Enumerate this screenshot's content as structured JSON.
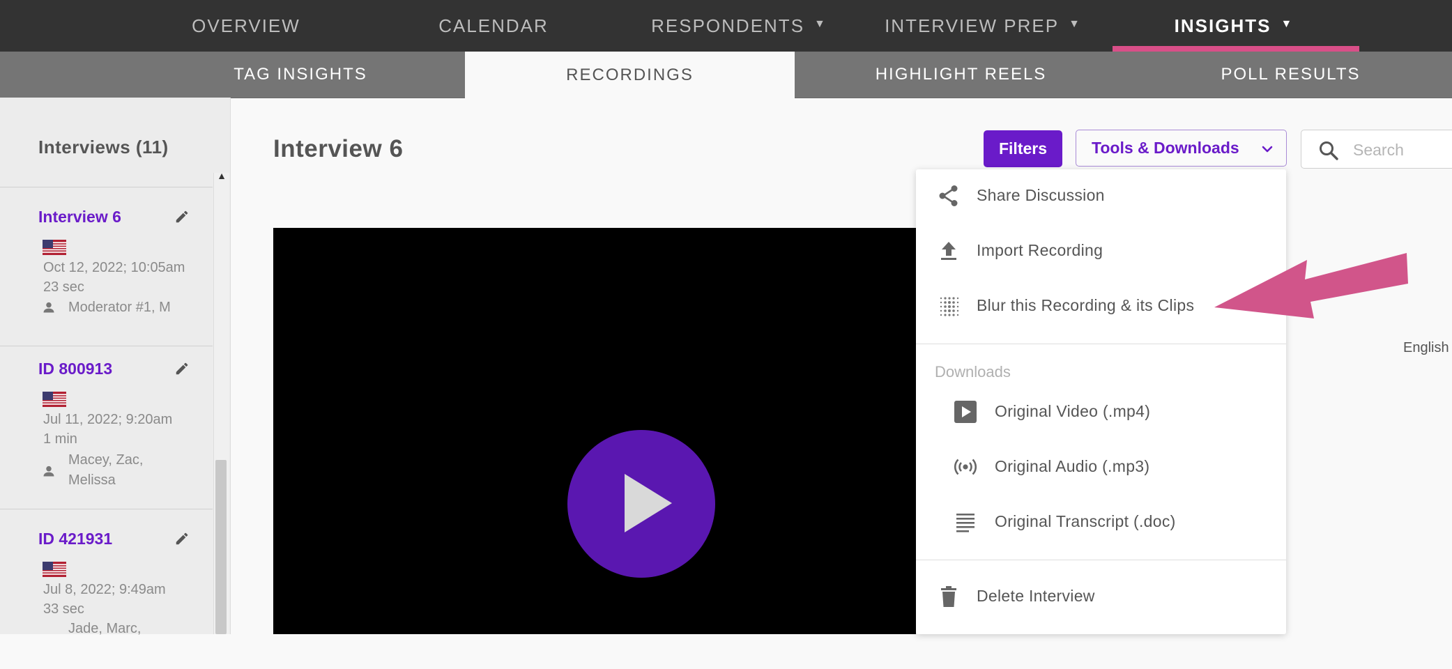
{
  "top_nav": {
    "items": [
      {
        "label": "OVERVIEW",
        "has_caret": false
      },
      {
        "label": "CALENDAR",
        "has_caret": false
      },
      {
        "label": "RESPONDENTS",
        "has_caret": true
      },
      {
        "label": "INTERVIEW PREP",
        "has_caret": true
      },
      {
        "label": "INSIGHTS",
        "has_caret": true,
        "active": true
      }
    ],
    "caret": "▼"
  },
  "sub_nav": {
    "items": [
      {
        "label": "TAG INSIGHTS"
      },
      {
        "label": "RECORDINGS",
        "active": true
      },
      {
        "label": "HIGHLIGHT REELS"
      },
      {
        "label": "POLL RESULTS"
      }
    ]
  },
  "sidebar": {
    "title": "Interviews (11)",
    "scroll_up_glyph": "▲",
    "interviews": [
      {
        "name": "Interview 6",
        "flag": "us-flag-icon",
        "date": "Oct 12, 2022; 10:05am",
        "duration": "23 sec",
        "people": "Moderator #1, M"
      },
      {
        "name": "ID 800913",
        "flag": "us-flag-icon",
        "date": "Jul 11, 2022; 9:20am",
        "duration": "1 min",
        "people_line1": "Macey, Zac,",
        "people_line2": "Melissa"
      },
      {
        "name": "ID 421931",
        "flag": "us-flag-icon",
        "date": "Jul 8, 2022; 9:49am",
        "duration": "33 sec",
        "people": "Jade, Marc,"
      }
    ]
  },
  "main": {
    "title": "Interview 6",
    "filters_label": "Filters",
    "tools_label": "Tools & Downloads",
    "search_placeholder": "Search",
    "language": "English"
  },
  "dropdown": {
    "items": [
      {
        "label": "Share Discussion",
        "icon": "share-icon"
      },
      {
        "label": "Import Recording",
        "icon": "upload-icon"
      },
      {
        "label": "Blur this Recording & its Clips",
        "icon": "blur-icon"
      }
    ],
    "downloads_header": "Downloads",
    "downloads": [
      {
        "label": "Original Video (.mp4)",
        "icon": "video-play-icon"
      },
      {
        "label": "Original Audio (.mp3)",
        "icon": "audio-broadcast-icon"
      },
      {
        "label": "Original Transcript (.doc)",
        "icon": "transcript-lines-icon"
      }
    ],
    "delete_label": "Delete Interview"
  },
  "colors": {
    "top_nav_bg": "#333333",
    "sub_nav_bg": "#757575",
    "accent_purple": "#6a1bc9",
    "active_underline": "#d94f88",
    "annotation_arrow": "#d1558a"
  }
}
